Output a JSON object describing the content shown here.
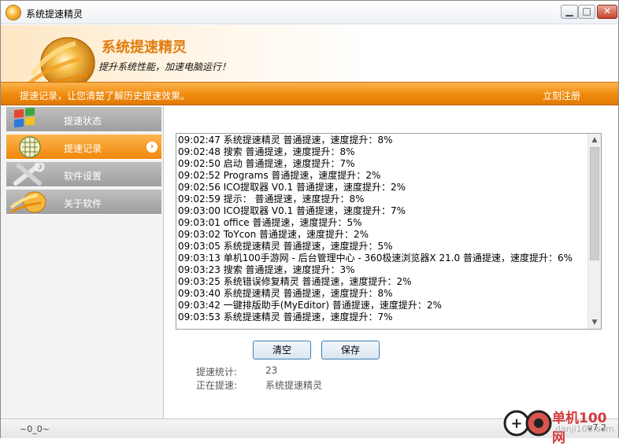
{
  "window": {
    "title": "系统提速精灵"
  },
  "window_controls": {
    "minimize": "▁",
    "maximize": "□",
    "close": "✕"
  },
  "banner": {
    "title": "系统提速精灵",
    "subtitle": "提升系统性能，加速电脑运行！"
  },
  "strip": {
    "text": "提速记录，让您清楚了解历史提速效果。",
    "register": "立刻注册"
  },
  "sidebar": {
    "items": [
      {
        "label": "提速状态",
        "icon": "windows-logo-icon",
        "active": false
      },
      {
        "label": "提速记录",
        "icon": "record-grid-icon",
        "active": true
      },
      {
        "label": "软件设置",
        "icon": "tools-icon",
        "active": false
      },
      {
        "label": "关于软件",
        "icon": "app-logo-icon",
        "active": false
      }
    ]
  },
  "log": {
    "lines": [
      "09:02:47 系统提速精灵 普通提速，速度提升：8%",
      "09:02:48 搜索 普通提速，速度提升：8%",
      "09:02:50 启动 普通提速，速度提升：7%",
      "09:02:52 Programs 普通提速，速度提升：2%",
      "09:02:56 ICO提取器 V0.1 普通提速，速度提升：2%",
      "09:02:59 提示： 普通提速，速度提升：8%",
      "09:03:00 ICO提取器 V0.1 普通提速，速度提升：7%",
      "09:03:01 office 普通提速，速度提升：5%",
      "09:03:02 ToYcon 普通提速，速度提升：2%",
      "09:03:05 系统提速精灵 普通提速，速度提升：5%",
      "09:03:13 单机100手游网 - 后台管理中心 - 360极速浏览器X 21.0 普通提速，速度提升：6%",
      "09:03:23 搜索 普通提速，速度提升：3%",
      "09:03:25 系统错误修复精灵 普通提速，速度提升：2%",
      "09:03:40 系统提速精灵 普通提速，速度提升：8%",
      "09:03:42 一键排版助手(MyEditor) 普通提速，速度提升：2%",
      "09:03:53 系统提速精灵 普通提速，速度提升：7%"
    ]
  },
  "buttons": {
    "clear": "清空",
    "save": "保存"
  },
  "stats": {
    "count_label": "提速统计:",
    "count_value": "23",
    "current_label": "正在提速:",
    "current_value": "系统提速精灵"
  },
  "status": {
    "left": "~0_0~",
    "version": "v7.2"
  },
  "watermark": {
    "text": "单机100网",
    "sub": "danji100.com"
  },
  "colors": {
    "accent": "#f08a0c",
    "nav_inactive": "#a8a8a8",
    "button_border": "#3c7fb1"
  }
}
